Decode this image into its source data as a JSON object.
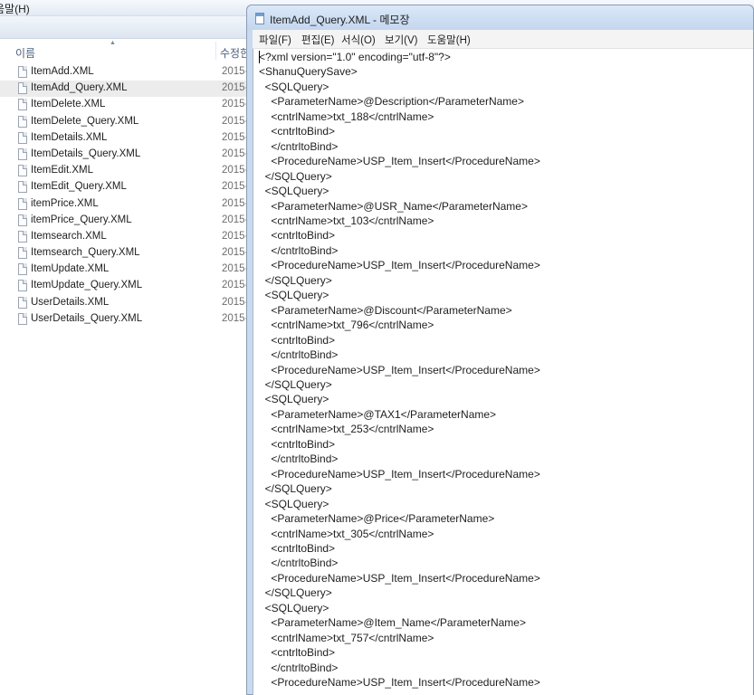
{
  "explorer": {
    "menu_help": "움말(H)",
    "columns": {
      "name": "이름",
      "date": "수정한"
    },
    "files": [
      {
        "name": "ItemAdd.XML",
        "date": "2015-",
        "selected": false
      },
      {
        "name": "ItemAdd_Query.XML",
        "date": "2015-",
        "selected": true
      },
      {
        "name": "ItemDelete.XML",
        "date": "2015-",
        "selected": false
      },
      {
        "name": "ItemDelete_Query.XML",
        "date": "2015-",
        "selected": false
      },
      {
        "name": "ItemDetails.XML",
        "date": "2015-",
        "selected": false
      },
      {
        "name": "ItemDetails_Query.XML",
        "date": "2015-",
        "selected": false
      },
      {
        "name": "ItemEdit.XML",
        "date": "2015-",
        "selected": false
      },
      {
        "name": "ItemEdit_Query.XML",
        "date": "2015-",
        "selected": false
      },
      {
        "name": "itemPrice.XML",
        "date": "2015-",
        "selected": false
      },
      {
        "name": "itemPrice_Query.XML",
        "date": "2015-",
        "selected": false
      },
      {
        "name": "Itemsearch.XML",
        "date": "2015-",
        "selected": false
      },
      {
        "name": "Itemsearch_Query.XML",
        "date": "2015-",
        "selected": false
      },
      {
        "name": "ItemUpdate.XML",
        "date": "2015-",
        "selected": false
      },
      {
        "name": "ItemUpdate_Query.XML",
        "date": "2015-",
        "selected": false
      },
      {
        "name": "UserDetails.XML",
        "date": "2015-",
        "selected": false
      },
      {
        "name": "UserDetails_Query.XML",
        "date": "2015-",
        "selected": false
      }
    ]
  },
  "notepad": {
    "title": "ItemAdd_Query.XML - 메모장",
    "menu": {
      "file": "파일(F)",
      "edit": "편집(E)",
      "format": "서식(O)",
      "view": "보기(V)",
      "help": "도움말(H)"
    },
    "lines": [
      "<?xml version=\"1.0\" encoding=\"utf-8\"?>",
      "<ShanuQuerySave>",
      "  <SQLQuery>",
      "    <ParameterName>@Description</ParameterName>",
      "    <cntrlName>txt_188</cntrlName>",
      "    <cntrltoBind>",
      "    </cntrltoBind>",
      "    <ProcedureName>USP_Item_Insert</ProcedureName>",
      "  </SQLQuery>",
      "  <SQLQuery>",
      "    <ParameterName>@USR_Name</ParameterName>",
      "    <cntrlName>txt_103</cntrlName>",
      "    <cntrltoBind>",
      "    </cntrltoBind>",
      "    <ProcedureName>USP_Item_Insert</ProcedureName>",
      "  </SQLQuery>",
      "  <SQLQuery>",
      "    <ParameterName>@Discount</ParameterName>",
      "    <cntrlName>txt_796</cntrlName>",
      "    <cntrltoBind>",
      "    </cntrltoBind>",
      "    <ProcedureName>USP_Item_Insert</ProcedureName>",
      "  </SQLQuery>",
      "  <SQLQuery>",
      "    <ParameterName>@TAX1</ParameterName>",
      "    <cntrlName>txt_253</cntrlName>",
      "    <cntrltoBind>",
      "    </cntrltoBind>",
      "    <ProcedureName>USP_Item_Insert</ProcedureName>",
      "  </SQLQuery>",
      "  <SQLQuery>",
      "    <ParameterName>@Price</ParameterName>",
      "    <cntrlName>txt_305</cntrlName>",
      "    <cntrltoBind>",
      "    </cntrltoBind>",
      "    <ProcedureName>USP_Item_Insert</ProcedureName>",
      "  </SQLQuery>",
      "  <SQLQuery>",
      "    <ParameterName>@Item_Name</ParameterName>",
      "    <cntrlName>txt_757</cntrlName>",
      "    <cntrltoBind>",
      "    </cntrltoBind>",
      "    <ProcedureName>USP_Item_Insert</ProcedureName>"
    ]
  }
}
